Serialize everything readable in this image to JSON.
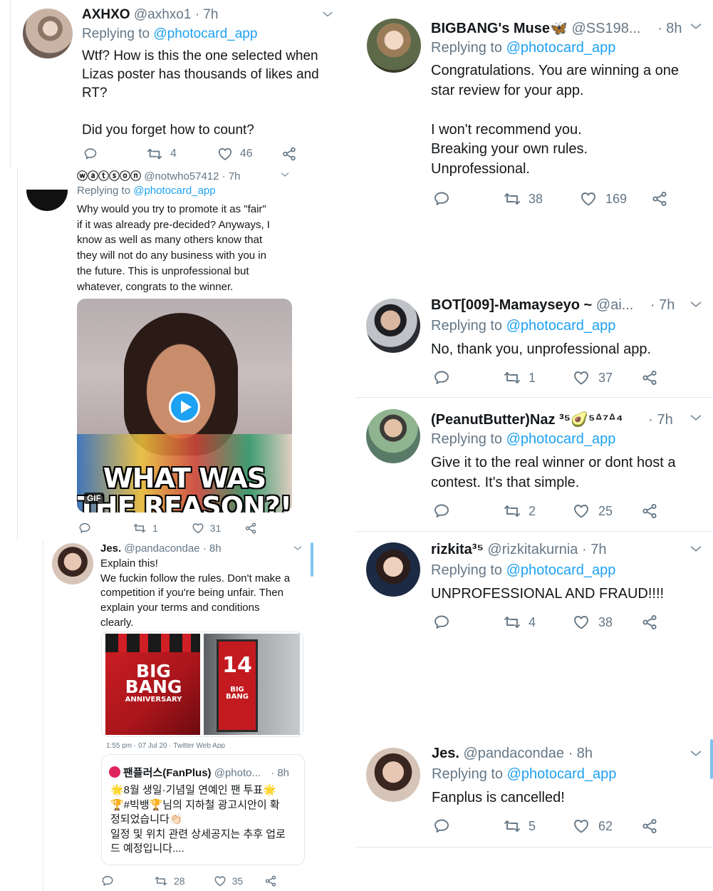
{
  "tweets": {
    "t1": {
      "name": "AXHXO",
      "handle": "@axhxo1 · 7h",
      "replying_prefix": "Replying to ",
      "replying_to": "@photocard_app",
      "text": "Wtf? How is this the one selected when\nLizas poster has thousands of likes and\nRT?\n\nDid you forget how to count?",
      "retweets": "4",
      "likes": "46"
    },
    "t2": {
      "name": "ⓦⓐⓣⓢⓞⓝ",
      "handle": "@notwho57412 · 7h",
      "replying_prefix": "Replying to ",
      "replying_to": "@photocard_app",
      "text": "Why would you try to promote it as \"fair\"\nif it was already pre-decided? Anyways, I\nknow as well as many others know that\nthey will not do any business with you in\nthe future. This is unprofessional but\nwhatever, congrats to the winner.",
      "gif_caption_line1": "WHAT WAS",
      "gif_caption_line2": "THE REASON?!",
      "gif_badge": "GIF",
      "retweets": "1",
      "likes": "31"
    },
    "t3": {
      "name": "Jes.",
      "handle": "@pandacondae · 8h",
      "text": "Explain this!\nWe fuckin follow the rules. Don't make a\ncompetition if you're being unfair. Then\nexplain your terms and conditions\nclearly.",
      "poster_big": "BIG",
      "poster_bang": "BANG",
      "poster_anniv": "ANNIVERSARY",
      "poster_14": "14",
      "meta": "1:55 pm · 07 Jul 20 · Twitter Web App",
      "quote_name": "팬플러스(FanPlus)",
      "quote_handle": "@photo...",
      "quote_time": "· 8h",
      "quote_text": "🌟8월 생일·기념일 연예인 팬 투표🌟\n🏆#빅뱅🏆님의 지하철 광고시안이 확\n정되었습니다👏🏻\n일정 및 위치 관련 상세공지는 추후 업로\n드 예정입니다....",
      "retweets": "28",
      "likes": "35"
    },
    "r1": {
      "name": "BIGBANG's Muse🦋",
      "handle": "@SS198...",
      "time": "· 8h",
      "replying_prefix": "Replying to ",
      "replying_to": "@photocard_app",
      "text": "Congratulations. You are winning a one\nstar review for your app.\n\nI won't recommend you.\nBreaking your own rules.\nUnprofessional.",
      "retweets": "38",
      "likes": "169"
    },
    "r2": {
      "name": "BOT[009]-Mamayseyo ~",
      "handle": "@ai...",
      "time": "· 7h",
      "replying_prefix": "Replying to ",
      "replying_to": "@photocard_app",
      "text": "No, thank you, unprofessional app.",
      "retweets": "1",
      "likes": "37"
    },
    "r3": {
      "name": "(PeanutButter)Naz ³⁵🥑⁵ᐞ⁷ᐞ⁴",
      "handle": "",
      "time": "· 7h",
      "replying_prefix": "Replying to ",
      "replying_to": "@photocard_app",
      "text": "Give it to the real winner or dont host a\ncontest. It's that simple.",
      "retweets": "2",
      "likes": "25"
    },
    "r4": {
      "name": "rizkita³⁵",
      "handle": "@rizkitakurnia · 7h",
      "replying_prefix": "Replying to ",
      "replying_to": "@photocard_app",
      "text": "UNPROFESSIONAL AND FRAUD!!!!",
      "retweets": "4",
      "likes": "38"
    },
    "r5": {
      "name": "Jes.",
      "handle": "@pandacondae · 8h",
      "replying_prefix": "Replying to ",
      "replying_to": "@photocard_app",
      "text": "Fanplus is cancelled!",
      "retweets": "5",
      "likes": "62"
    }
  },
  "icons": {
    "reply": "reply-icon",
    "retweet": "retweet-icon",
    "like": "heart-icon",
    "share": "share-icon",
    "more": "chevron-down-icon",
    "play": "play-icon"
  },
  "colors": {
    "link": "#1da1f2",
    "secondary": "#657786",
    "divider": "#e1e8ed"
  }
}
